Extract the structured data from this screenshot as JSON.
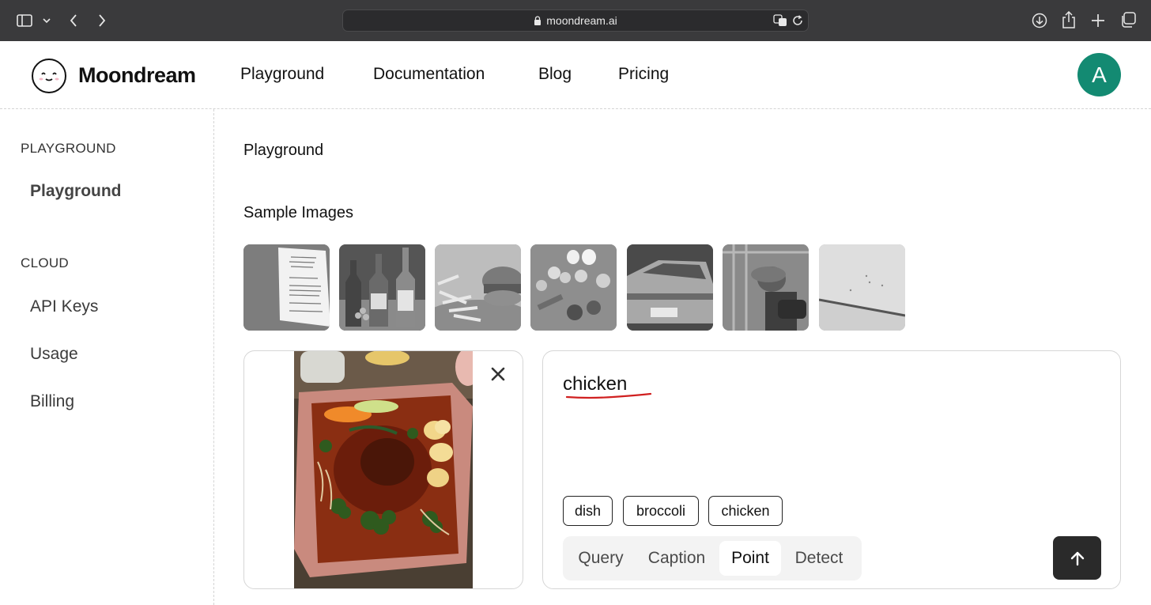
{
  "browser": {
    "url": "moondream.ai"
  },
  "header": {
    "brand": "Moondream",
    "nav": [
      "Playground",
      "Documentation",
      "Blog",
      "Pricing"
    ],
    "avatar_initial": "A"
  },
  "sidebar": {
    "sections": [
      {
        "label": "PLAYGROUND",
        "items": [
          {
            "label": "Playground",
            "active": true
          }
        ]
      },
      {
        "label": "CLOUD",
        "items": [
          {
            "label": "API Keys"
          },
          {
            "label": "Usage"
          },
          {
            "label": "Billing"
          }
        ]
      }
    ]
  },
  "main": {
    "title": "Playground",
    "sample_title": "Sample Images",
    "samples": [
      "receipt",
      "wine-bottles",
      "burger-fries",
      "vegetables",
      "delorean-car",
      "worker",
      "white-surface"
    ],
    "query": {
      "text": "chicken",
      "chips": [
        "dish",
        "broccoli",
        "chicken"
      ],
      "modes": [
        "Query",
        "Caption",
        "Point",
        "Detect"
      ],
      "active_mode": "Point"
    }
  },
  "colors": {
    "accent": "#138a72",
    "chrome": "#3a3a3c",
    "submit": "#2a2a2a",
    "squiggle": "#d02020"
  }
}
